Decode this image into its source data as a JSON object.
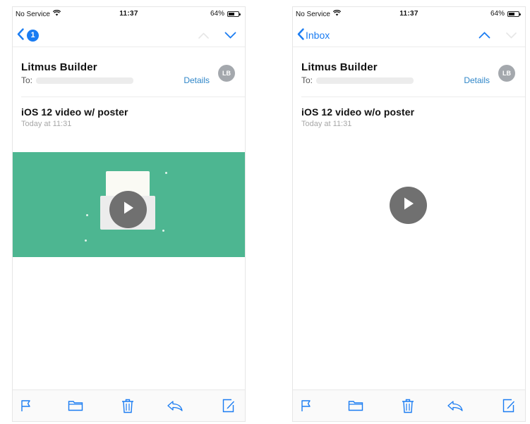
{
  "colors": {
    "accent": "#1a7cf2",
    "details_link": "#2f86c8",
    "poster_green": "#4db691",
    "play_button": "#707070",
    "avatar_bg": "#a4a8ad",
    "secondary_text": "#a7a7a7"
  },
  "screens": [
    {
      "status": {
        "carrier": "No Service",
        "time": "11:37",
        "battery": "64%",
        "battery_level": 0.64
      },
      "nav": {
        "back_badge": "1",
        "back_label": ""
      },
      "email": {
        "sender": "Litmus Builder",
        "to_label": "To:",
        "details": "Details",
        "avatar_initials": "LB",
        "subject": "iOS 12 video w/ poster",
        "time": "Today at 11:31"
      }
    },
    {
      "status": {
        "carrier": "No Service",
        "time": "11:37",
        "battery": "64%",
        "battery_level": 0.64
      },
      "nav": {
        "back_label": "Inbox"
      },
      "email": {
        "sender": "Litmus Builder",
        "to_label": "To:",
        "details": "Details",
        "avatar_initials": "LB",
        "subject": "iOS 12 video w/o poster",
        "time": "Today at 11:31"
      }
    }
  ],
  "toolbar_icons": [
    "flag-icon",
    "folder-icon",
    "trash-icon",
    "reply-icon",
    "compose-icon"
  ]
}
